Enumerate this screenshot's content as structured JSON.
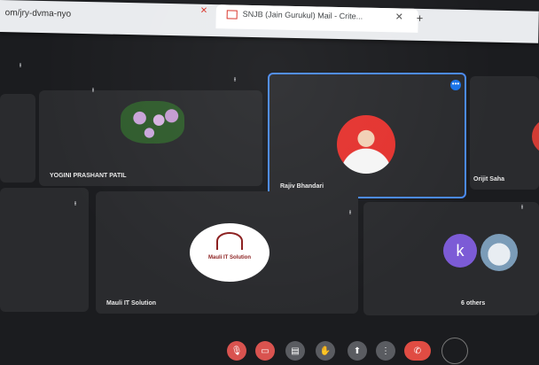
{
  "browser": {
    "url": "om/jry-dvma-nyo",
    "active_tab_title": "SNJB (Jain Gurukul) Mail - Crite...",
    "new_tab_label": "+",
    "close_label": "✕"
  },
  "participants": [
    {
      "id": "yogini",
      "name": "YOGINI PRASHANT PATIL"
    },
    {
      "id": "rajiv",
      "name": "Rajiv Bhandari",
      "active": true
    },
    {
      "id": "orijit",
      "name": "Orijit Saha"
    },
    {
      "id": "mauli",
      "name": "Mauli IT Solution",
      "logo_text": "Mauli IT Solution"
    },
    {
      "id": "others",
      "name": "6 others",
      "avatar_letter": "k"
    }
  ],
  "icons": {
    "mic_off": "mic-off-icon",
    "more": "more-options-icon",
    "gmail": "gmail-icon"
  },
  "controls": {
    "more_options_glyph": "⋮",
    "leave_glyph": "✆"
  },
  "colors": {
    "active_border": "#4a8af4",
    "end_call": "#e04c43",
    "avatar_k": "#7c5bd6"
  }
}
